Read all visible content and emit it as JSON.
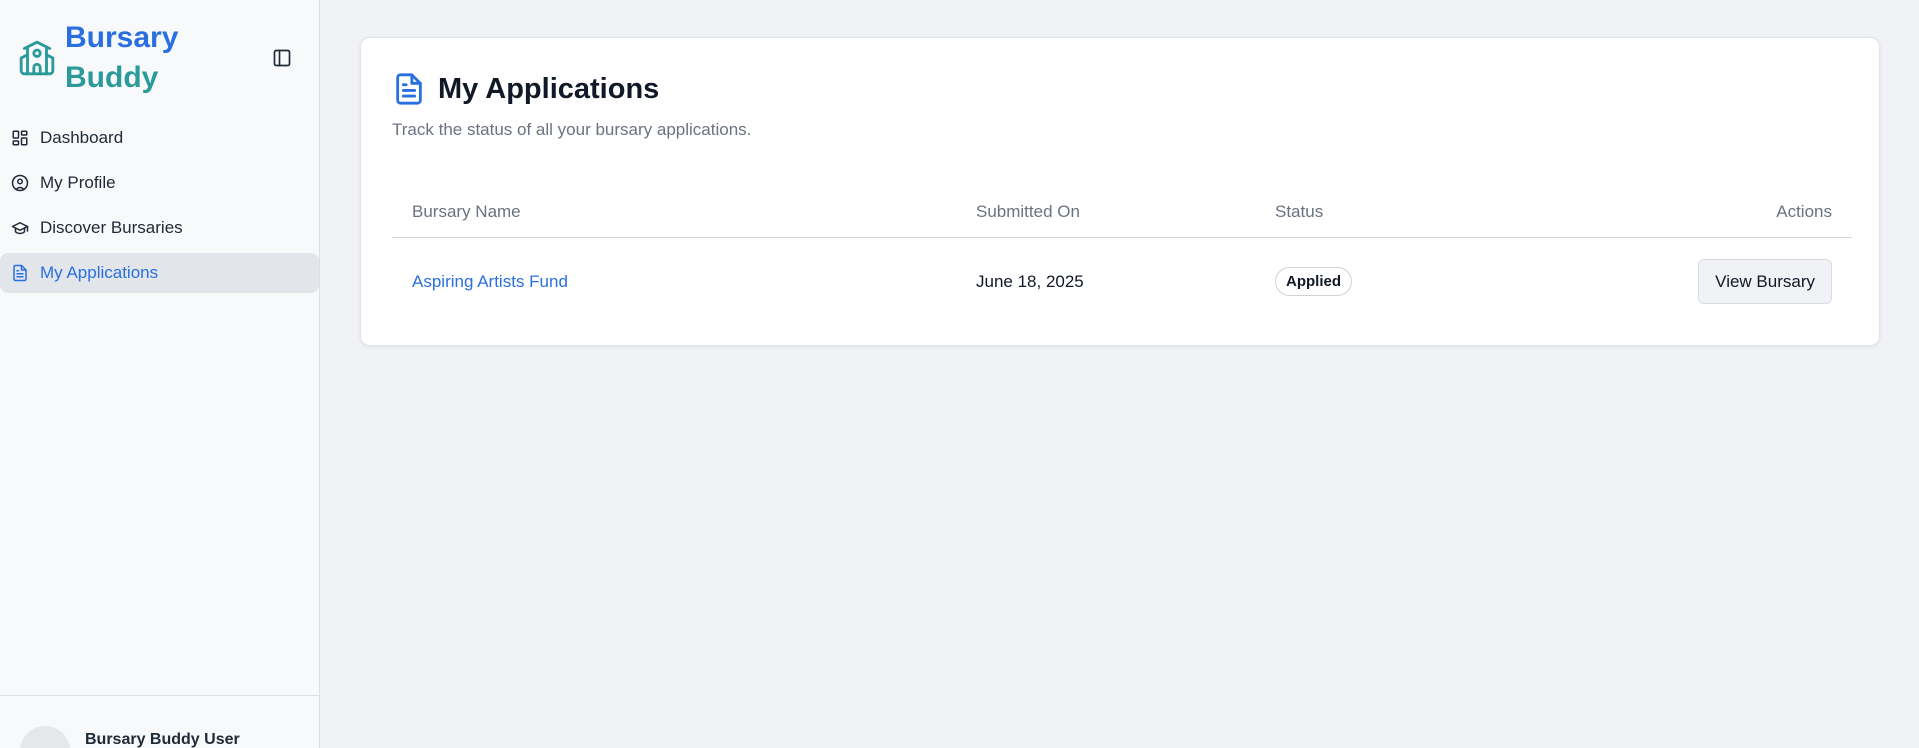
{
  "brand": {
    "line1": "Bursary",
    "line2": "Buddy",
    "icon": "school-icon",
    "colors": {
      "primary": "#2a6fe0",
      "secondary": "#2a9a9a"
    }
  },
  "sidebar": {
    "toggle_icon": "sidebar-toggle-icon",
    "items": [
      {
        "label": "Dashboard",
        "icon": "dashboard-icon",
        "active": false
      },
      {
        "label": "My Profile",
        "icon": "user-circle-icon",
        "active": false
      },
      {
        "label": "Discover Bursaries",
        "icon": "graduation-cap-icon",
        "active": false
      },
      {
        "label": "My Applications",
        "icon": "document-icon",
        "active": true
      }
    ],
    "user": {
      "name": "Bursary Buddy User"
    }
  },
  "main": {
    "title": "My Applications",
    "subtitle": "Track the status of all your bursary applications.",
    "table": {
      "headers": [
        "Bursary Name",
        "Submitted On",
        "Status",
        "Actions"
      ],
      "rows": [
        {
          "name": "Aspiring Artists Fund",
          "submitted": "June 18, 2025",
          "status": "Applied",
          "action": "View Bursary"
        }
      ]
    }
  }
}
